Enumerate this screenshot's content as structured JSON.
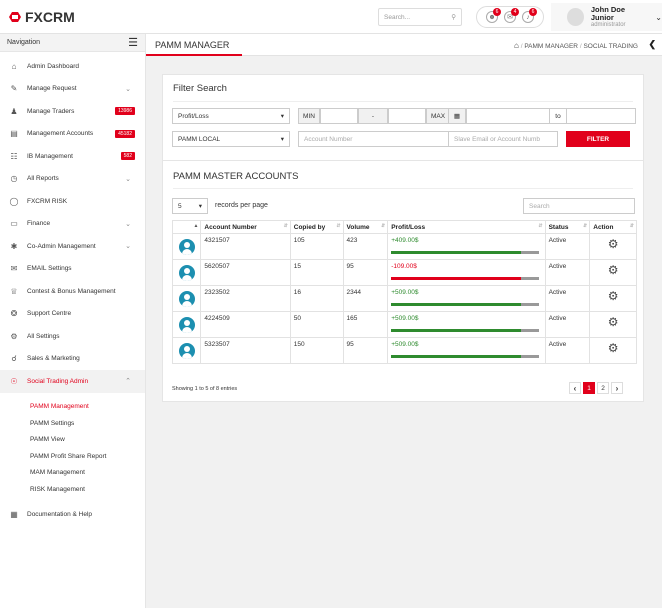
{
  "app": {
    "logo_text": "FXCRM"
  },
  "topbar": {
    "search_placeholder": "Search...",
    "notif_badges": [
      "6",
      "4",
      "6"
    ],
    "user_name": "John Doe Junior",
    "user_role": "administrator"
  },
  "sidebar": {
    "heading": "Navigation",
    "items": [
      {
        "label": "Admin Dashboard",
        "icon": "home-icon"
      },
      {
        "label": "Manage Request",
        "icon": "request-icon",
        "chevron": true
      },
      {
        "label": "Manage Traders",
        "icon": "traders-icon",
        "badge": "13986"
      },
      {
        "label": "Management Accounts",
        "icon": "accounts-icon",
        "badge": "45182"
      },
      {
        "label": "IB Management",
        "icon": "sitemap-icon",
        "badge": "582"
      },
      {
        "label": "All Reports",
        "icon": "reports-icon",
        "chevron": true
      },
      {
        "label": "FXCRM RISK",
        "icon": "shield-icon"
      },
      {
        "label": "Finance",
        "icon": "folder-icon",
        "chevron": true
      },
      {
        "label": "Co-Admin Management",
        "icon": "asterisk-icon",
        "chevron": true
      },
      {
        "label": "EMAIL Settings",
        "icon": "envelope-icon"
      },
      {
        "label": "Contest & Bonus Management",
        "icon": "trophy-icon"
      },
      {
        "label": "Support Centre",
        "icon": "support-icon"
      },
      {
        "label": "All Settings",
        "icon": "gear-icon"
      },
      {
        "label": "Sales & Marketing",
        "icon": "megaphone-icon"
      },
      {
        "label": "Social Trading Admin",
        "icon": "globe-icon",
        "chevron_up": true
      }
    ],
    "subitems": [
      "PAMM Management",
      "PAMM Settings",
      "PAMM View",
      "PAMM Profit Share Report",
      "MAM Management",
      "RISK Management"
    ],
    "footer_item": {
      "label": "Documentation & Help",
      "icon": "document-icon"
    }
  },
  "page": {
    "title": "PAMM MANAGER",
    "breadcrumb": [
      "PAMM MANAGER",
      "SOCIAL TRADING"
    ]
  },
  "filter": {
    "title": "Filter Search",
    "pl_select": "Profit/Loss",
    "min_label": "MIN",
    "dash": "-",
    "max_label": "MAX",
    "to_label": "to",
    "type_select": "PAMM LOCAL",
    "account_placeholder": "Account Number",
    "slave_placeholder": "Slave Email or Account Numb",
    "filter_button": "FILTER"
  },
  "accounts": {
    "title": "PAMM MASTER ACCOUNTS",
    "page_size": "5",
    "records_label": "records per page",
    "search_placeholder": "Search",
    "columns": [
      "Account Number",
      "Copied by",
      "Volume",
      "Profit/Loss",
      "Status",
      "Action"
    ],
    "rows": [
      {
        "account": "4321507",
        "copied": "105",
        "volume": "423",
        "pl": "+409.00$",
        "bar_color": "#2e8b2e",
        "bar_pct": 88,
        "status": "Active"
      },
      {
        "account": "5620507",
        "copied": "15",
        "volume": "95",
        "pl": "-109.00$",
        "bar_color": "#e1001b",
        "bar_pct": 88,
        "status": "Active"
      },
      {
        "account": "2323502",
        "copied": "16",
        "volume": "2344",
        "pl": "+509.00$",
        "bar_color": "#2e8b2e",
        "bar_pct": 88,
        "status": "Active"
      },
      {
        "account": "4224509",
        "copied": "50",
        "volume": "165",
        "pl": "+509.00$",
        "bar_color": "#2e8b2e",
        "bar_pct": 88,
        "status": "Active"
      },
      {
        "account": "5323507",
        "copied": "150",
        "volume": "95",
        "pl": "+509.00$",
        "bar_color": "#2e8b2e",
        "bar_pct": 88,
        "status": "Active"
      }
    ],
    "info": "Showing 1 to 5 of 8 entries",
    "pages": [
      "1",
      "2"
    ]
  }
}
